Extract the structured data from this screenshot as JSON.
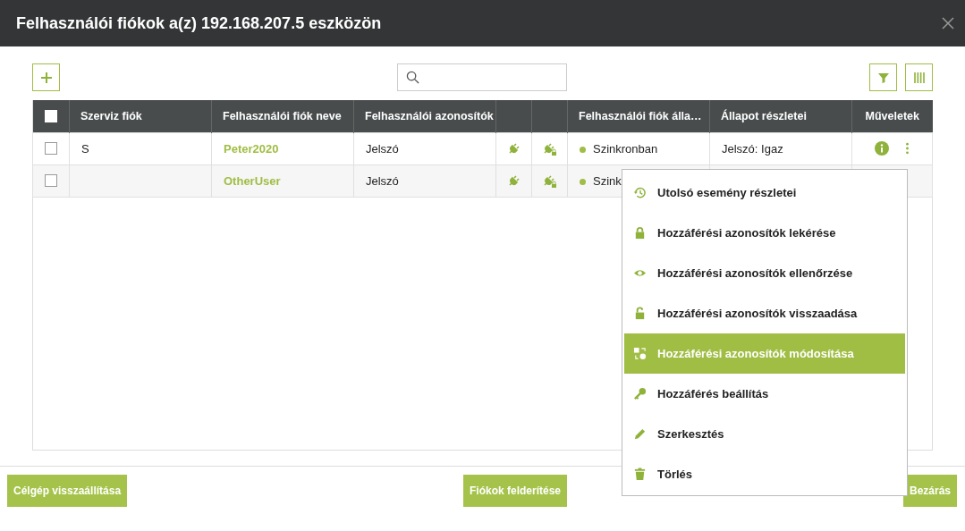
{
  "window": {
    "title": "Felhasználói fiókok a(z) 192.168.207.5 eszközön"
  },
  "table": {
    "select_all": {
      "checked": false
    },
    "columns": [
      "Szerviz fiók",
      "Felhasználói fiók neve",
      "Felhasználói azonosítók",
      "",
      "",
      "Felhasználói fiók álla…",
      "Állapot részletei",
      "Műveletek"
    ],
    "rows": [
      {
        "checked": false,
        "service": "S",
        "name": "Peter2020",
        "credential": "Jelszó",
        "status": "Szinkronban",
        "color": "#a0bd44",
        "details": "Jelszó: Igaz",
        "actions": true
      },
      {
        "checked": false,
        "service": "",
        "name": "OtherUser",
        "credential": "Jelszó",
        "status": "Szink",
        "color": "#a0bd44",
        "actions": false
      }
    ]
  },
  "menu": {
    "items": [
      {
        "kind": "history",
        "label": "Utolsó esemény részletei",
        "selected": false
      },
      {
        "kind": "lock",
        "label": "Hozzáférési azonosítók lekérése",
        "selected": false
      },
      {
        "kind": "eye",
        "label": "Hozzáférési azonosítók ellenőrzése",
        "selected": false
      },
      {
        "kind": "unlock",
        "label": "Hozzáférési azonosítók visszaadása",
        "selected": false
      },
      {
        "kind": "swap",
        "label": "Hozzáférési azonosítók módosítása",
        "selected": true
      },
      {
        "kind": "key",
        "label": "Hozzáférés beállítás",
        "selected": false
      },
      {
        "kind": "pencil",
        "label": "Szerkesztés",
        "selected": false
      },
      {
        "kind": "trash",
        "label": "Törlés",
        "selected": false
      }
    ]
  },
  "footer": {
    "buttons": [
      "Célgép visszaállítása",
      "Fiókok felderítése",
      "Bezárás"
    ]
  }
}
